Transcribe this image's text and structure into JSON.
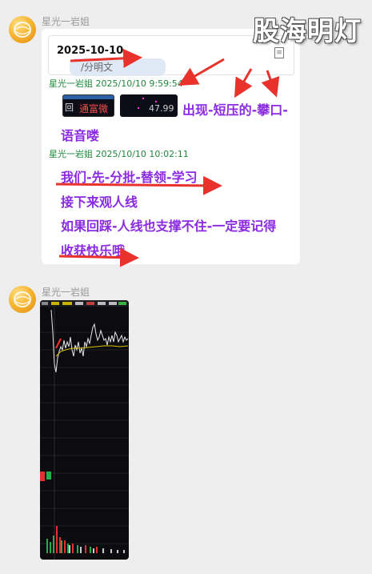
{
  "watermark": "股海明灯",
  "messages": [
    {
      "sender": "星光一岩姐",
      "quote": {
        "date": "2025-10-10",
        "sub": "/分明文"
      },
      "time1": "星光一岩姐 2025/10/10 9:59:54",
      "thumbs": [
        {
          "label": "通富微",
          "prefix": "回"
        },
        {
          "label": "47.99"
        }
      ],
      "line1_a": "出现-短压的-攀口-",
      "line1_b": "语音喽",
      "time2": "星光一岩姐 2025/10/10 10:02:11",
      "lines": [
        "我们-先-分批-替领-学习",
        "接下来观人线",
        "如果回踩-人线也支撑不住-一定要记得",
        "收获快乐哦"
      ]
    },
    {
      "sender": "星光一岩姐",
      "image": "stock-intraday-chart"
    }
  ],
  "colors": {
    "purple_text": "#8a2be2",
    "meta_green": "#1e8a3c",
    "arrow_red": "#e8322b"
  }
}
